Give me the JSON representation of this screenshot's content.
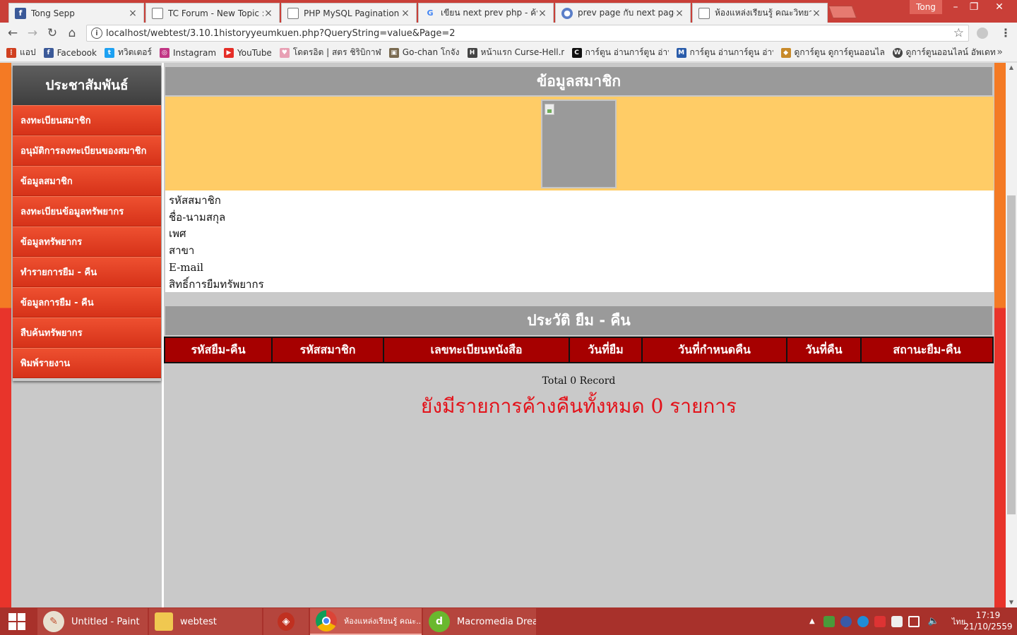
{
  "browser": {
    "tabs": [
      {
        "label": "Tong Sepp",
        "icon": "facebook-icon",
        "color": "#3b5998",
        "glyph": "f"
      },
      {
        "label": "TC Forum - New Topic :: ",
        "icon": "document-icon",
        "color": "#ffffff",
        "glyph": ""
      },
      {
        "label": "PHP MySQL Pagination",
        "icon": "document-icon",
        "color": "#ffffff",
        "glyph": ""
      },
      {
        "label": "เขียน next prev php - ค้น",
        "icon": "google-icon",
        "color": "#ffffff",
        "glyph": "G"
      },
      {
        "label": "prev page กับ next page",
        "icon": "globe-icon",
        "color": "#5a7ec8",
        "glyph": "●"
      },
      {
        "label": "ห้องแหล่งเรียนรู้ คณะวิทยากร",
        "icon": "document-icon",
        "color": "#ffffff",
        "glyph": ""
      }
    ],
    "profile_name": "Tong",
    "url": "localhost/webtest/3.10.1historyyeumkuen.php?QueryString=value&Page=2",
    "bookmarks": [
      {
        "label": "แอป",
        "icon": "apps-grid-icon",
        "color": "#d04020",
        "glyph": "⋮"
      },
      {
        "label": "Facebook",
        "icon": "facebook-icon",
        "color": "#3b5998",
        "glyph": "f"
      },
      {
        "label": "ทวิตเตอร์",
        "icon": "twitter-icon",
        "color": "#1da1f2",
        "glyph": "t"
      },
      {
        "label": "Instagram",
        "icon": "instagram-icon",
        "color": "#c13584",
        "glyph": "◎"
      },
      {
        "label": "YouTube",
        "icon": "youtube-icon",
        "color": "#e52d27",
        "glyph": "▶"
      },
      {
        "label": "โดตรอิต | สตร ชิริบิกาฬ",
        "icon": "heart-icon",
        "color": "#e8a0b4",
        "glyph": "♥"
      },
      {
        "label": "Go-chan โกจัง",
        "icon": "photo-icon",
        "color": "#7a6a50",
        "glyph": "▣"
      },
      {
        "label": "หน้าแรก Curse-Hell.net",
        "icon": "h-logo-icon",
        "color": "#444444",
        "glyph": "H"
      },
      {
        "label": "การ์ตูน อ่านการ์ตูน อ่าน",
        "icon": "c-logo-icon",
        "color": "#111111",
        "glyph": "C"
      },
      {
        "label": "การ์ตูน อ่านการ์ตูน อ่าน",
        "icon": "m-logo-icon",
        "color": "#2a5caa",
        "glyph": "M"
      },
      {
        "label": "ดูการ์ตูน ดูการ์ตูนออนไลน์",
        "icon": "anime-icon",
        "color": "#c88a2a",
        "glyph": "◆"
      },
      {
        "label": "ดูการ์ตูนออนไลน์ อัพเดท",
        "icon": "wordpress-icon",
        "color": "#444444",
        "glyph": "W"
      }
    ]
  },
  "sidebar": {
    "title": "ประชาสัมพันธ์",
    "items": [
      {
        "label": "ลงทะเบียนสมาชิก"
      },
      {
        "label": "อนุมัติการลงทะเบียนของสมาชิก"
      },
      {
        "label": "ข้อมูลสมาชิก"
      },
      {
        "label": "ลงทะเบียนข้อมูลทรัพยากร"
      },
      {
        "label": "ข้อมูลทรัพยากร"
      },
      {
        "label": "ทำรายการยืม - คืน"
      },
      {
        "label": "ข้อมูลการยืม - คืน"
      },
      {
        "label": "สืบค้นทรัพยากร"
      },
      {
        "label": "พิมพ์รายงาน"
      }
    ]
  },
  "member": {
    "title": "ข้อมูลสมาชิก",
    "fields": [
      {
        "label": "รหัสสมาชิก"
      },
      {
        "label": "ชื่อ-นามสกุล"
      },
      {
        "label": "เพศ"
      },
      {
        "label": "สาขา"
      },
      {
        "label": "E-mail"
      },
      {
        "label": "สิทธิ์การยืมทรัพยากร"
      }
    ]
  },
  "history": {
    "title": "ประวัติ ยืม - คืน",
    "columns": [
      {
        "label": "รหัสยืม-คืน"
      },
      {
        "label": "รหัสสมาชิก"
      },
      {
        "label": "เลขทะเบียนหนังสือ"
      },
      {
        "label": "วันที่ยืม"
      },
      {
        "label": "วันที่กำหนดคืน"
      },
      {
        "label": "วันที่คืน"
      },
      {
        "label": "สถานะยืม-คืน"
      }
    ],
    "total_text": "Total 0 Record",
    "outstanding_text": "ยังมีรายการค้างคืนทั้งหมด 0 รายการ"
  },
  "taskbar": {
    "tasks": [
      {
        "label": "Untitled - Paint",
        "icon": "paint-icon",
        "color": "#e8e0d0"
      },
      {
        "label": "webtest",
        "icon": "folder-icon",
        "color": "#f0c850"
      },
      {
        "label": "",
        "icon": "app-bag-icon",
        "color": "#c03020"
      },
      {
        "label": "ห้องแหล่งเรียนรู้ คณะ...",
        "icon": "chrome-icon",
        "color": "#4caf50"
      },
      {
        "label": "Macromedia Drea...",
        "icon": "dreamweaver-icon",
        "color": "#6ab82e"
      }
    ],
    "language": "ไทย",
    "time": "17:19",
    "date": "21/10/2559"
  },
  "colors": {
    "sidebar_item": "#e04426",
    "table_header": "#a60000",
    "photo_band": "#ffcc66",
    "outstanding_text": "#e3121a"
  }
}
